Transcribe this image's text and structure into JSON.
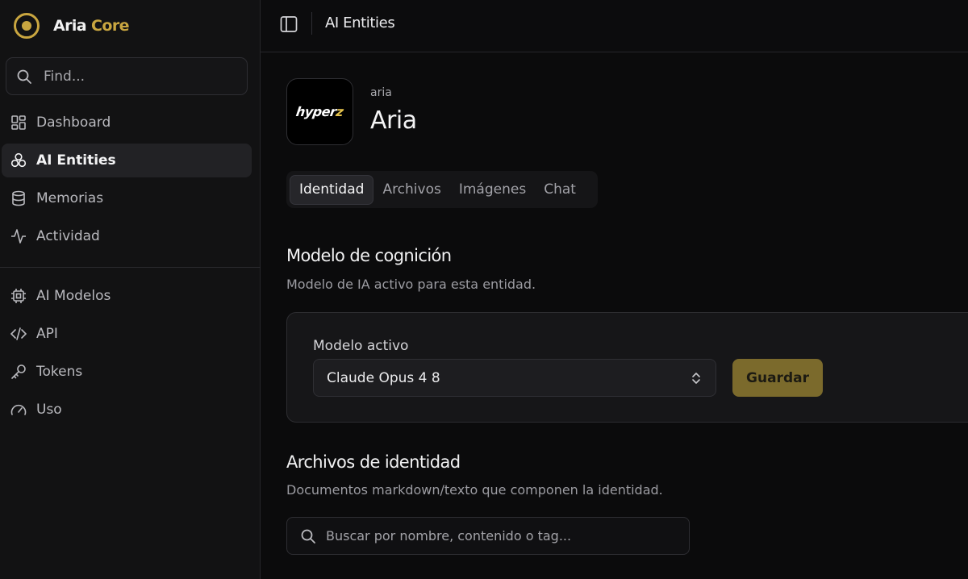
{
  "brand": {
    "name_primary": "Aria",
    "name_accent": "Core",
    "accent_color": "#c9a640"
  },
  "sidebar": {
    "search_placeholder": "Find...",
    "items": [
      {
        "label": "Dashboard",
        "icon": "dashboard-icon"
      },
      {
        "label": "AI Entities",
        "icon": "entities-icon",
        "active": true
      },
      {
        "label": "Memorias",
        "icon": "database-icon"
      },
      {
        "label": "Actividad",
        "icon": "activity-icon"
      }
    ],
    "items2": [
      {
        "label": "AI Modelos",
        "icon": "cpu-icon"
      },
      {
        "label": "API",
        "icon": "code-icon"
      },
      {
        "label": "Tokens",
        "icon": "key-icon"
      },
      {
        "label": "Uso",
        "icon": "gauge-icon"
      }
    ]
  },
  "topbar": {
    "title": "AI Entities"
  },
  "entity": {
    "slug": "aria",
    "name": "Aria",
    "avatar_text": "hyper",
    "avatar_text_accent": "z"
  },
  "tabs": [
    {
      "label": "Identidad",
      "active": true
    },
    {
      "label": "Archivos"
    },
    {
      "label": "Imágenes"
    },
    {
      "label": "Chat"
    }
  ],
  "model_section": {
    "title": "Modelo de cognición",
    "description": "Modelo de IA activo para esta entidad.",
    "field_label": "Modelo activo",
    "selected_model": "Claude Opus 4 8",
    "save_label": "Guardar"
  },
  "files_section": {
    "title": "Archivos de identidad",
    "description": "Documentos markdown/texto que componen la identidad.",
    "search_placeholder": "Buscar por nombre, contenido o tag..."
  }
}
